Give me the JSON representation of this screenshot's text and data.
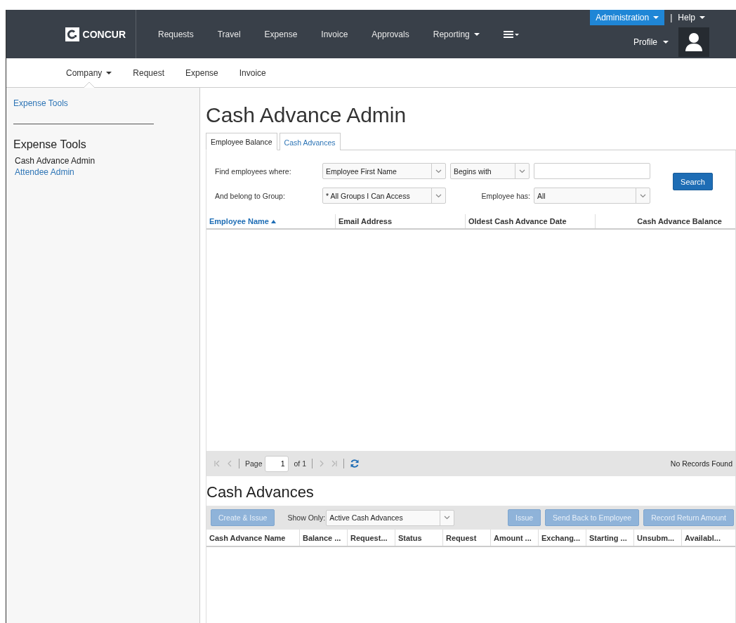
{
  "header": {
    "logo": "CONCUR",
    "nav": [
      {
        "label": "Requests",
        "dropdown": false
      },
      {
        "label": "Travel",
        "dropdown": false
      },
      {
        "label": "Expense",
        "dropdown": false
      },
      {
        "label": "Invoice",
        "dropdown": false
      },
      {
        "label": "Approvals",
        "dropdown": false
      },
      {
        "label": "Reporting",
        "dropdown": true
      }
    ],
    "admin": "Administration",
    "separator": "|",
    "help": "Help",
    "profile": "Profile"
  },
  "subnav": [
    {
      "label": "Company",
      "dropdown": true,
      "selected": true
    },
    {
      "label": "Request",
      "dropdown": false,
      "selected": false
    },
    {
      "label": "Expense",
      "dropdown": false,
      "selected": false
    },
    {
      "label": "Invoice",
      "dropdown": false,
      "selected": false
    }
  ],
  "sidebar": {
    "top_link": "Expense Tools",
    "heading": "Expense Tools",
    "items": [
      {
        "label": "Cash Advance Admin",
        "selected": true
      },
      {
        "label": "Attendee Admin",
        "selected": false
      }
    ]
  },
  "page_title": "Cash Advance Admin",
  "tabs": [
    {
      "label": "Employee Balance",
      "selected": true
    },
    {
      "label": "Cash Advances",
      "selected": false
    }
  ],
  "filters": {
    "find_label": "Find employees where:",
    "field": "Employee First Name",
    "operator": "Begins with",
    "group_label": "And belong to Group:",
    "group": "* All Groups I Can Access",
    "has_label": "Employee has:",
    "has": "All",
    "search": "Search"
  },
  "employee_table": {
    "columns": [
      {
        "label": "Employee Name",
        "sorted": true,
        "right_aligned": false
      },
      {
        "label": "Email Address",
        "sorted": false,
        "right_aligned": false
      },
      {
        "label": "Oldest Cash Advance Date",
        "sorted": false,
        "right_aligned": false
      },
      {
        "label": "Cash Advance Balance",
        "sorted": false,
        "right_aligned": true
      }
    ]
  },
  "pager": {
    "page_label": "Page",
    "page": "1",
    "of": "of 1",
    "status": "No Records Found"
  },
  "cash_advances": {
    "title": "Cash Advances",
    "create": {
      "label": "Create & Issue",
      "disabled": true
    },
    "show_only_label": "Show Only:",
    "show_only": "Active Cash Advances",
    "actions": [
      {
        "label": "Issue",
        "disabled": true
      },
      {
        "label": "Send Back to Employee",
        "disabled": true
      },
      {
        "label": "Record Return Amount",
        "disabled": true
      }
    ],
    "columns": [
      "Cash Advance Name",
      "Balance ...",
      "Request...",
      "Status",
      "Request",
      "Amount ...",
      "Exchang...",
      "Starting ...",
      "Unsubm...",
      "Availabl..."
    ]
  }
}
